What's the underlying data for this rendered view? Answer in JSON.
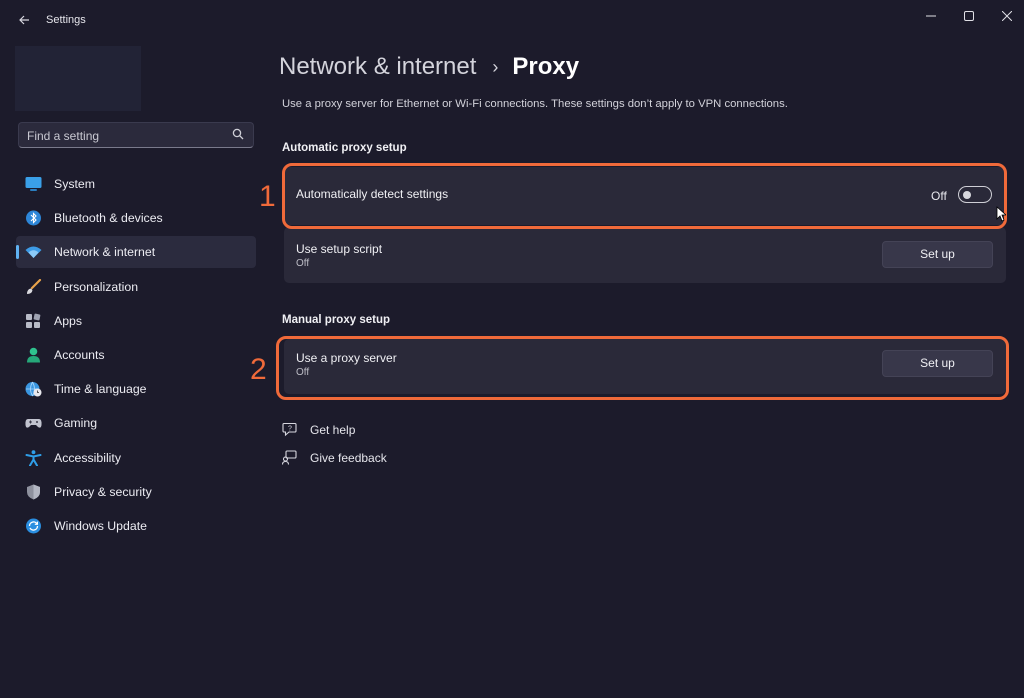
{
  "window": {
    "title": "Settings",
    "back_icon": "back-arrow-icon",
    "controls": {
      "minimize": "—",
      "maximize": "☐",
      "close": "✕"
    }
  },
  "search": {
    "placeholder": "Find a setting",
    "icon": "search-icon"
  },
  "sidebar": {
    "items": [
      {
        "label": "System",
        "icon": "monitor-icon",
        "active": false
      },
      {
        "label": "Bluetooth & devices",
        "icon": "bluetooth-icon",
        "active": false
      },
      {
        "label": "Network & internet",
        "icon": "wifi-icon",
        "active": true
      },
      {
        "label": "Personalization",
        "icon": "brush-icon",
        "active": false
      },
      {
        "label": "Apps",
        "icon": "apps-grid-icon",
        "active": false
      },
      {
        "label": "Accounts",
        "icon": "person-icon",
        "active": false
      },
      {
        "label": "Time & language",
        "icon": "globe-clock-icon",
        "active": false
      },
      {
        "label": "Gaming",
        "icon": "gamepad-icon",
        "active": false
      },
      {
        "label": "Accessibility",
        "icon": "accessibility-icon",
        "active": false
      },
      {
        "label": "Privacy & security",
        "icon": "shield-icon",
        "active": false
      },
      {
        "label": "Windows Update",
        "icon": "update-icon",
        "active": false
      }
    ]
  },
  "main": {
    "breadcrumb": {
      "parent": "Network & internet",
      "separator": "›",
      "current": "Proxy"
    },
    "description": "Use a proxy server for Ethernet or Wi-Fi connections. These settings don’t apply to VPN connections.",
    "automatic": {
      "title": "Automatic proxy setup",
      "detect": {
        "label": "Automatically detect settings",
        "toggle_label": "Off",
        "toggle_on": false
      },
      "script": {
        "label": "Use setup script",
        "sub": "Off",
        "button": "Set up"
      }
    },
    "manual": {
      "title": "Manual proxy setup",
      "proxy": {
        "label": "Use a proxy server",
        "sub": "Off",
        "button": "Set up"
      }
    },
    "links": {
      "help": {
        "label": "Get help",
        "icon": "help-chat-icon"
      },
      "feedback": {
        "label": "Give feedback",
        "icon": "feedback-icon"
      }
    }
  },
  "annotations": {
    "marker1": "1",
    "marker2": "2",
    "color": "#f06a3a"
  },
  "colors": {
    "accent": "#5fb2f2",
    "background": "#1c1b2b",
    "card": "#2a2939"
  }
}
